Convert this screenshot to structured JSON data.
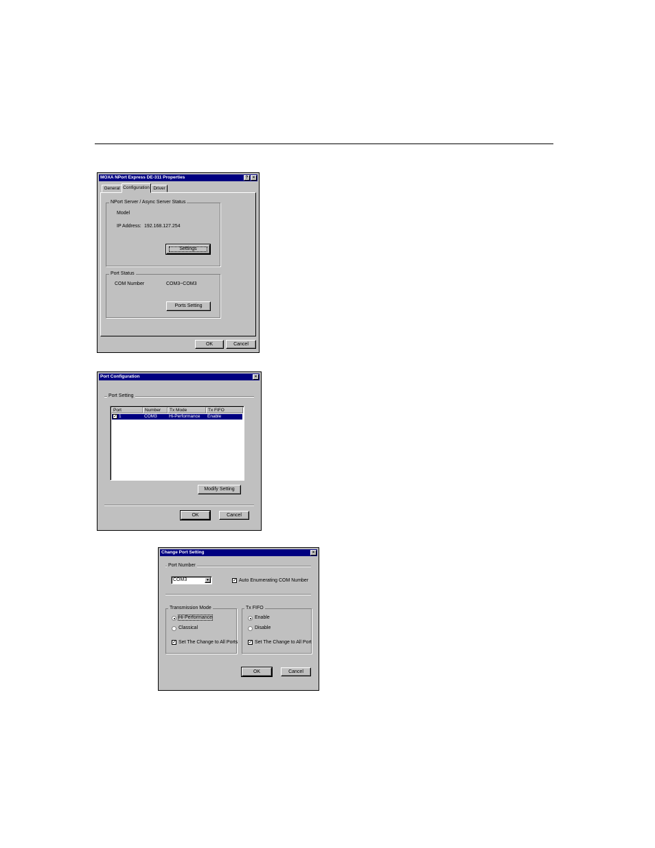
{
  "props_dialog": {
    "title": "MOXA NPort Express DE-311 Properties",
    "help_icon": "?",
    "close_icon": "×",
    "tabs": [
      "General",
      "Configuration",
      "Driver"
    ],
    "server_group": "NPort Server / Async Server Status",
    "model_label": "Model",
    "ip_label": "IP Address:",
    "ip_value": "192.168.127.254",
    "settings_button": "Settings",
    "port_group": "Port Status",
    "com_label": "COM Number",
    "com_value": "COM3~COM3",
    "ports_setting_button": "Ports Setting",
    "ok": "OK",
    "cancel": "Cancel"
  },
  "port_config_dialog": {
    "title": "Port Configuration",
    "close_icon": "×",
    "group": "Port Setting",
    "columns": [
      "Port",
      "Number",
      "Tx Mode",
      "Tx FIFO"
    ],
    "rows": [
      {
        "checked": "✓",
        "port": "1",
        "number": "COM3",
        "tx_mode": "Hi-Performance",
        "tx_fifo": "Enable"
      }
    ],
    "modify_button": "Modify Setting",
    "ok": "OK",
    "cancel": "Cancel"
  },
  "change_port_dialog": {
    "title": "Change Port Setting",
    "close_icon": "×",
    "port_number_label": "Port Number",
    "com_select": "COM3",
    "dropdown_icon": "▼",
    "auto_enum_label": "Auto Enumerating COM Number",
    "check_mark": "✓",
    "tx_mode_group": "Transmission Mode",
    "hi_perf": "Hi-Performance",
    "classical": "Classical",
    "set_all_ports": "Set The Change to All Ports",
    "tx_fifo_group": "Tx FIFO",
    "enable": "Enable",
    "disable": "Disable",
    "set_all_port": "Set The Change to All Port",
    "ok": "OK",
    "cancel": "Cancel"
  }
}
